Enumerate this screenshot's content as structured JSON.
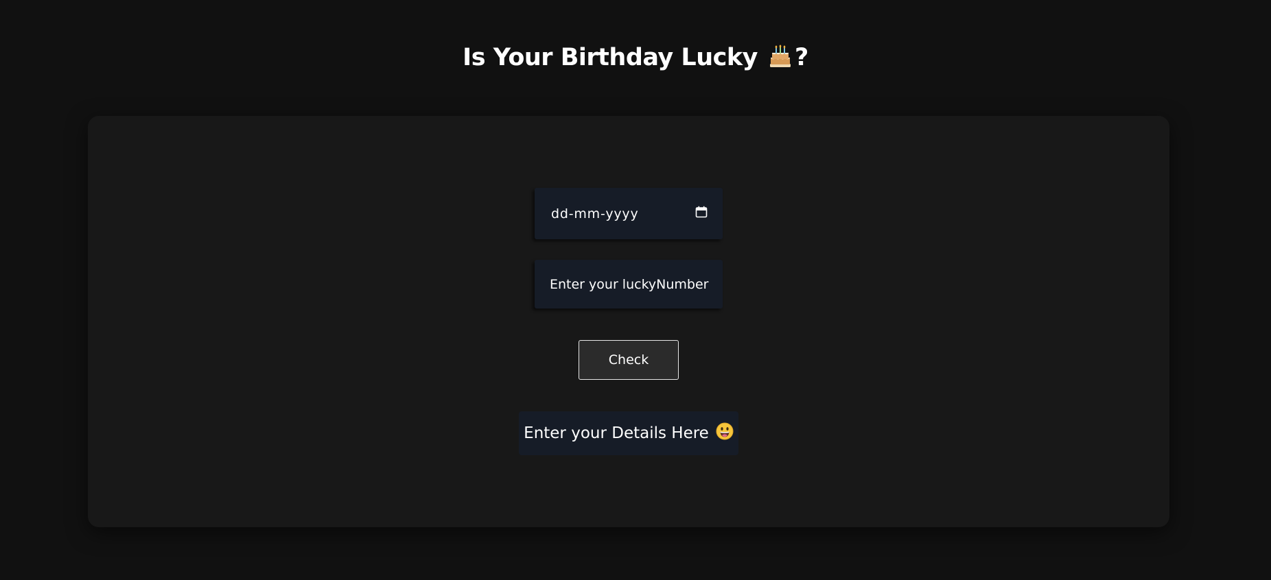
{
  "header": {
    "title": "Is Your Birthday Lucky",
    "title_icon": "birthday-cake-icon",
    "title_suffix": "?"
  },
  "form": {
    "date_input": {
      "placeholder": "dd-mm-yyyy",
      "icon": "calendar-icon"
    },
    "lucky_number_input": {
      "placeholder": "Enter your luckyNumber"
    },
    "check_button_label": "Check"
  },
  "output": {
    "message": "Enter your Details Here",
    "message_icon": "grinning-face-icon"
  },
  "colors": {
    "page_background": "#111111",
    "card_background": "#181818",
    "field_background": "#161c27",
    "button_background": "#2b2b2b",
    "text": "#ffffff"
  }
}
